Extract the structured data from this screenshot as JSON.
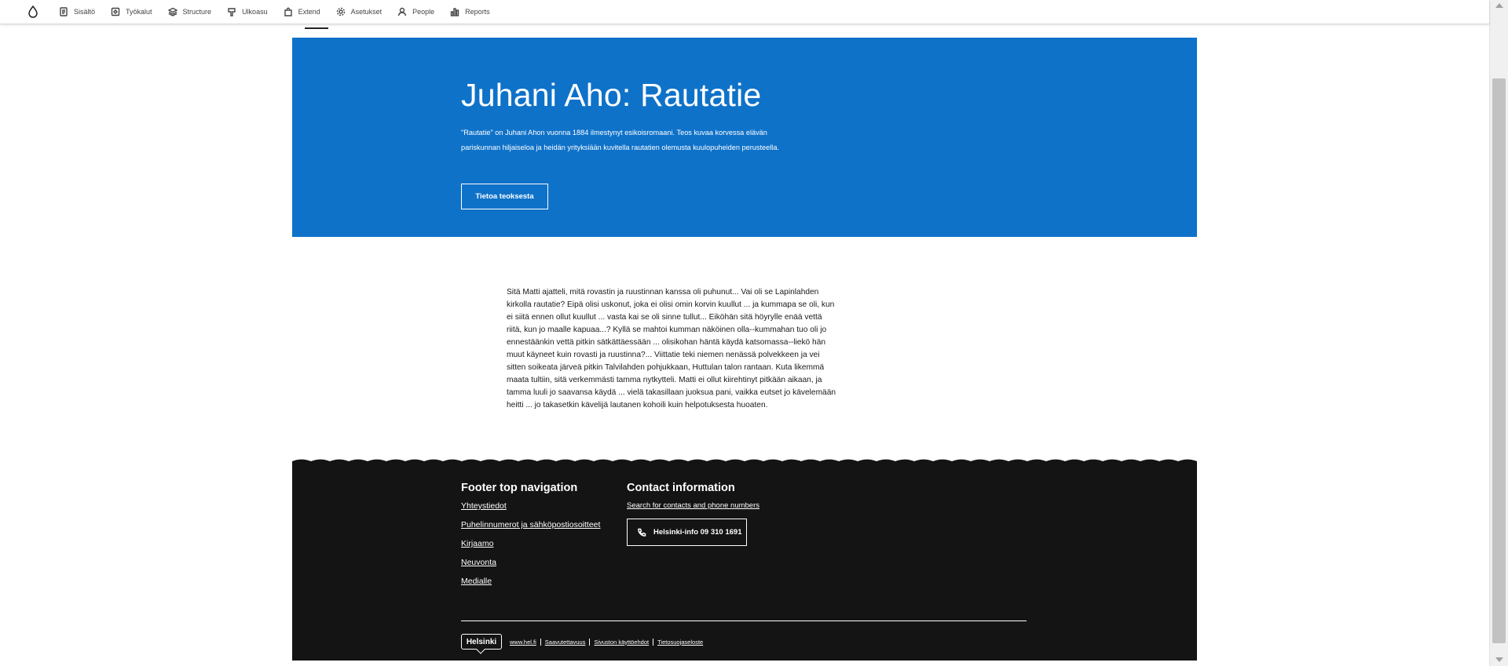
{
  "toolbar": {
    "items": [
      {
        "label": "Sisältö",
        "icon": "document-icon"
      },
      {
        "label": "Työkalut",
        "icon": "tools-icon"
      },
      {
        "label": "Structure",
        "icon": "layers-icon"
      },
      {
        "label": "Ulkoasu",
        "icon": "paint-icon"
      },
      {
        "label": "Extend",
        "icon": "puzzle-icon"
      },
      {
        "label": "Asetukset",
        "icon": "gear-icon"
      },
      {
        "label": "People",
        "icon": "person-icon"
      },
      {
        "label": "Reports",
        "icon": "chart-icon"
      }
    ]
  },
  "hero": {
    "title": "Juhani Aho: Rautatie",
    "description": "\"Rautatie\" on Juhani Ahon vuonna 1884 ilmestynyt esikoisromaani. Teos kuvaa korvessa elävän pariskunnan hiljaiseloa ja heidän yrityksiään kuvitella rautatien olemusta kuulopuheiden perusteella.",
    "button_label": "Tietoa teoksesta",
    "background": "#0f72c9"
  },
  "body": {
    "text": "Sitä Matti ajatteli, mitä rovastin ja ruustinnan kanssa oli puhunut... Vai oli se Lapinlahden kirkolla rautatie? Eipä olisi uskonut, joka ei olisi omin korvin kuullut ... ja kummapa se oli, kun ei siitä ennen ollut kuullut ... vasta kai se oli sinne tullut... Eiköhän sitä höyrylle enää vettä riitä, kun jo maalle kapuaa...? Kyllä se mahtoi kumman näköinen olla--kummahan tuo oli jo ennestäänkin vettä pitkin sätkättäessään ... olisikohan häntä käydä katsomassa--liekö hän muut käyneet kuin rovasti ja ruustinna?... Viittatie teki niemen nenässä polvekkeen ja vei sitten soikeata järveä pitkin Talvilahden pohjukkaan, Huttulan talon rantaan. Kuta likemmä maata tultiin, sitä verkemmästi tamma nytkytteli. Matti ei ollut kiirehtinyt pitkään aikaan, ja tamma luuli jo saavansa käydä ... vielä takasillaan juoksua pani, vaikka eutset jo kävelemään heitti ... jo takasetkin kävelijä lautanen kohoili kuin helpotuksesta huoaten."
  },
  "footer": {
    "nav_heading": "Footer top navigation",
    "nav_links": [
      "Yhteystiedot",
      "Puhelinnumerot ja sähköpostiosoitteet",
      "Kirjaamo",
      "Neuvonta",
      "Medialle"
    ],
    "contact_heading": "Contact information",
    "contact_link": "Search for contacts and phone numbers",
    "phone_button": "Helsinki-info 09 310 1691",
    "logo_text": "Helsinki",
    "bottom_links": [
      "www.hel.fi",
      "Saavutettavuus",
      "Sivuston käyttöehdot",
      "Tietosuojaseloste"
    ],
    "background": "#141414"
  }
}
